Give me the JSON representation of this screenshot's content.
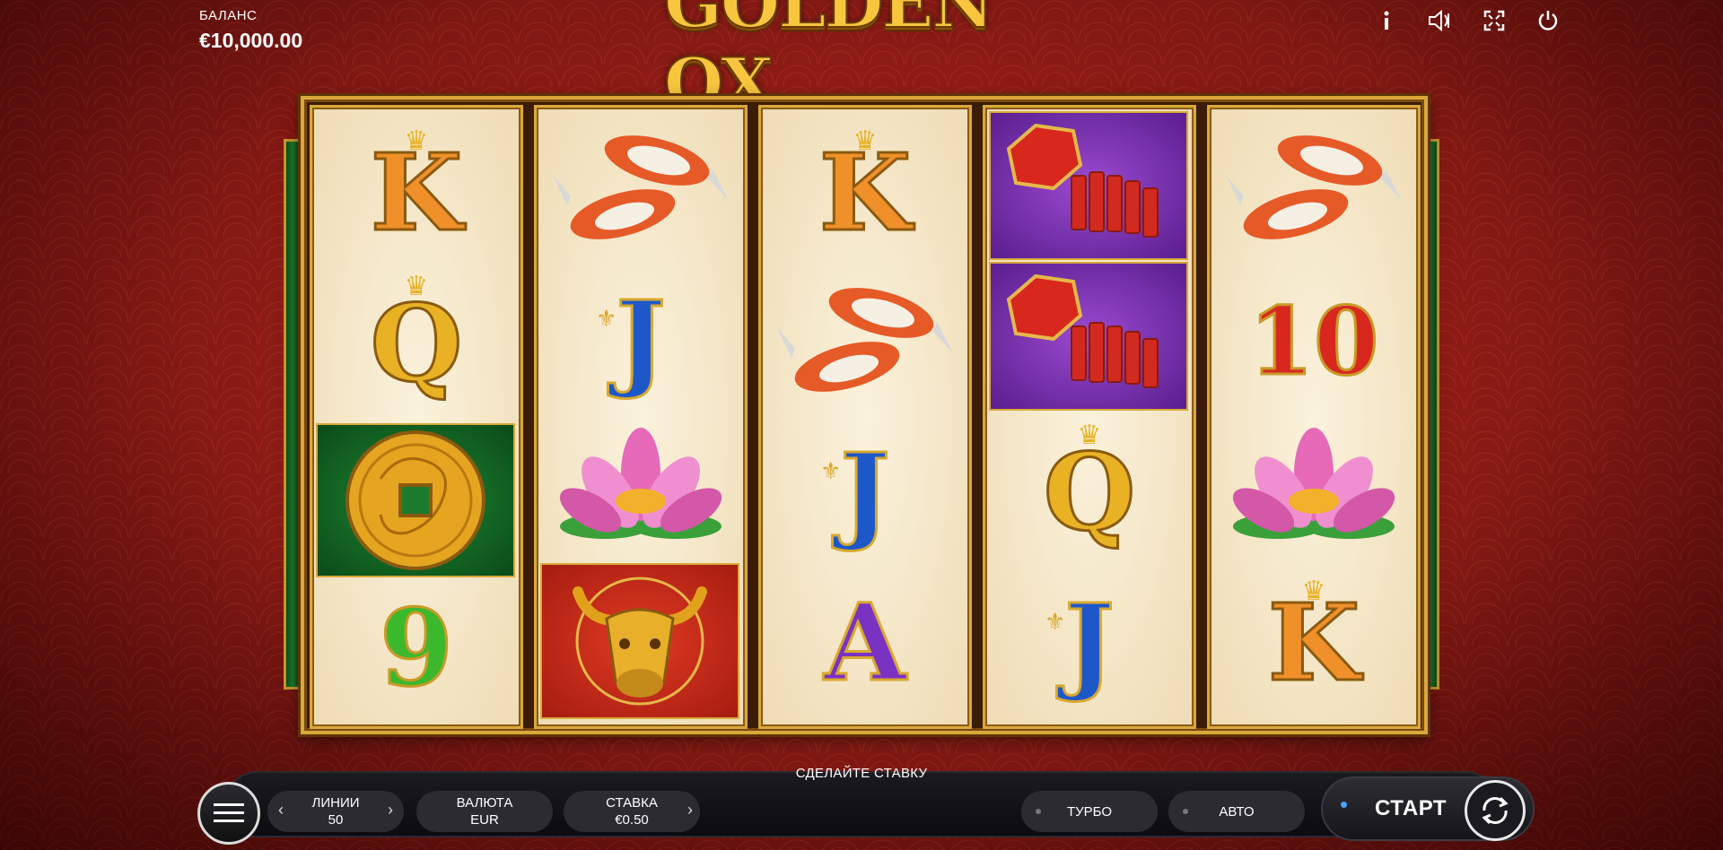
{
  "header": {
    "balance_label": "БАЛАНС",
    "balance_value": "€10,000.00",
    "logo_text": "GOLDEN OX",
    "icons": [
      "info-icon",
      "sound-icon",
      "fullscreen-icon",
      "power-icon"
    ]
  },
  "reels": [
    {
      "symbols": [
        "K",
        "Q",
        "coin",
        "9"
      ]
    },
    {
      "symbols": [
        "koi",
        "J",
        "lotus",
        "ox"
      ]
    },
    {
      "symbols": [
        "K",
        "koi",
        "J",
        "A"
      ]
    },
    {
      "symbols": [
        "firecrackers",
        "firecrackers",
        "Q",
        "J"
      ]
    },
    {
      "symbols": [
        "koi",
        "10",
        "lotus",
        "K"
      ]
    }
  ],
  "bottom": {
    "message": "СДЕЛАЙТЕ СТАВКУ",
    "lines_label": "ЛИНИИ",
    "lines_value": "50",
    "currency_label": "ВАЛЮТА",
    "currency_value": "EUR",
    "bet_label": "СТАВКА",
    "bet_value": "€0.50",
    "turbo_label": "ТУРБО",
    "auto_label": "АВТО",
    "start_label": "СТАРТ",
    "arrow_left": "‹",
    "arrow_right": "›"
  },
  "colors": {
    "background": "#8e1c16",
    "gold": "#d9a83a",
    "bar": "#111116",
    "start_dot": "#4aa0ff"
  }
}
